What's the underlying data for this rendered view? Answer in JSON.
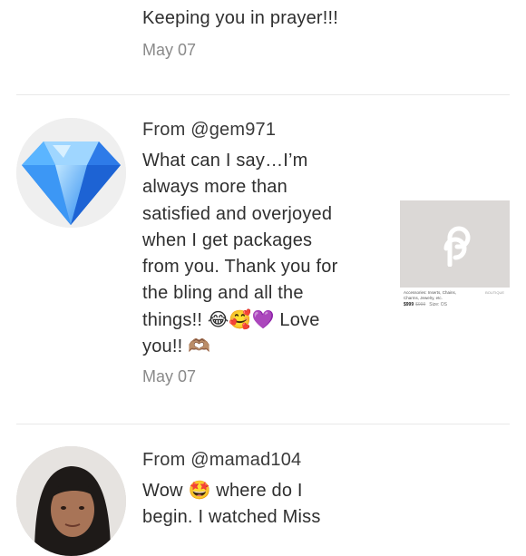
{
  "reviews": [
    {
      "author": "",
      "text": "Keeping you in prayer!!!",
      "date": "May 07"
    },
    {
      "author": "From @gem971",
      "text_lines": [
        "What can I say…I’m",
        "always more than",
        "satisfied and overjoyed",
        "when I get packages",
        "from you. Thank you for",
        "the bling and all the",
        "things!! 😂🥰💜 Love",
        "you!! 🫶🏽"
      ],
      "date": "May 07",
      "avatar": "diamond-icon"
    },
    {
      "author": "From @mamad104",
      "text_lines": [
        "Wow 🤩 where do I",
        "begin. I watched Miss"
      ],
      "avatar": "user-photo"
    }
  ],
  "listing": {
    "title": "Accessories: Inserts, Chains, Charms, Jewelry, etc.",
    "brand": "BOUTIQUE",
    "price": "$999",
    "original_price": "$999",
    "size": "Size: OS",
    "icon": "poshmark-logo-icon"
  },
  "colors": {
    "divider": "#e8e8e8",
    "listing_bg": "#dbd8d6",
    "date": "#8a8a8a"
  }
}
